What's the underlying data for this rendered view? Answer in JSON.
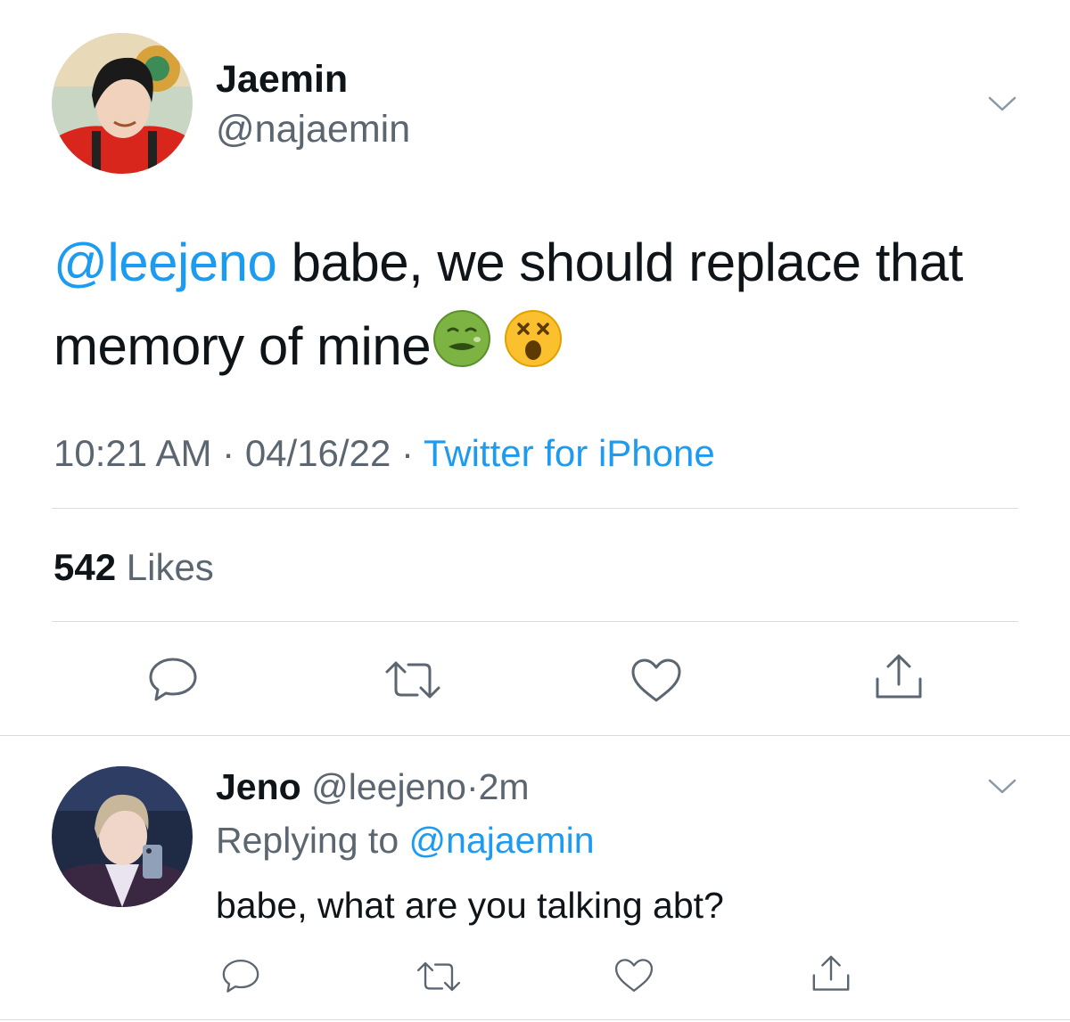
{
  "main_tweet": {
    "display_name": "Jaemin",
    "handle": "@najaemin",
    "mention": "@leejeno",
    "text_line1": " babe, we should replace that",
    "text_line2": "memory of mine",
    "emojis": [
      "nauseated-face",
      "dizzy-face"
    ],
    "time": "10:21 AM",
    "separator": "·",
    "date": "04/16/22",
    "source": "Twitter for iPhone",
    "likes_count": "542",
    "likes_label": "Likes"
  },
  "reply": {
    "display_name": "Jeno",
    "handle": "@leejeno",
    "separator": "·",
    "age": "2m",
    "replying_label": "Replying to",
    "replying_handle": "@najaemin",
    "text": "babe, what are you talking abt?"
  },
  "colors": {
    "link": "#1d9bf0",
    "secondary_text": "#5b6670",
    "divider": "#d9dde1"
  }
}
